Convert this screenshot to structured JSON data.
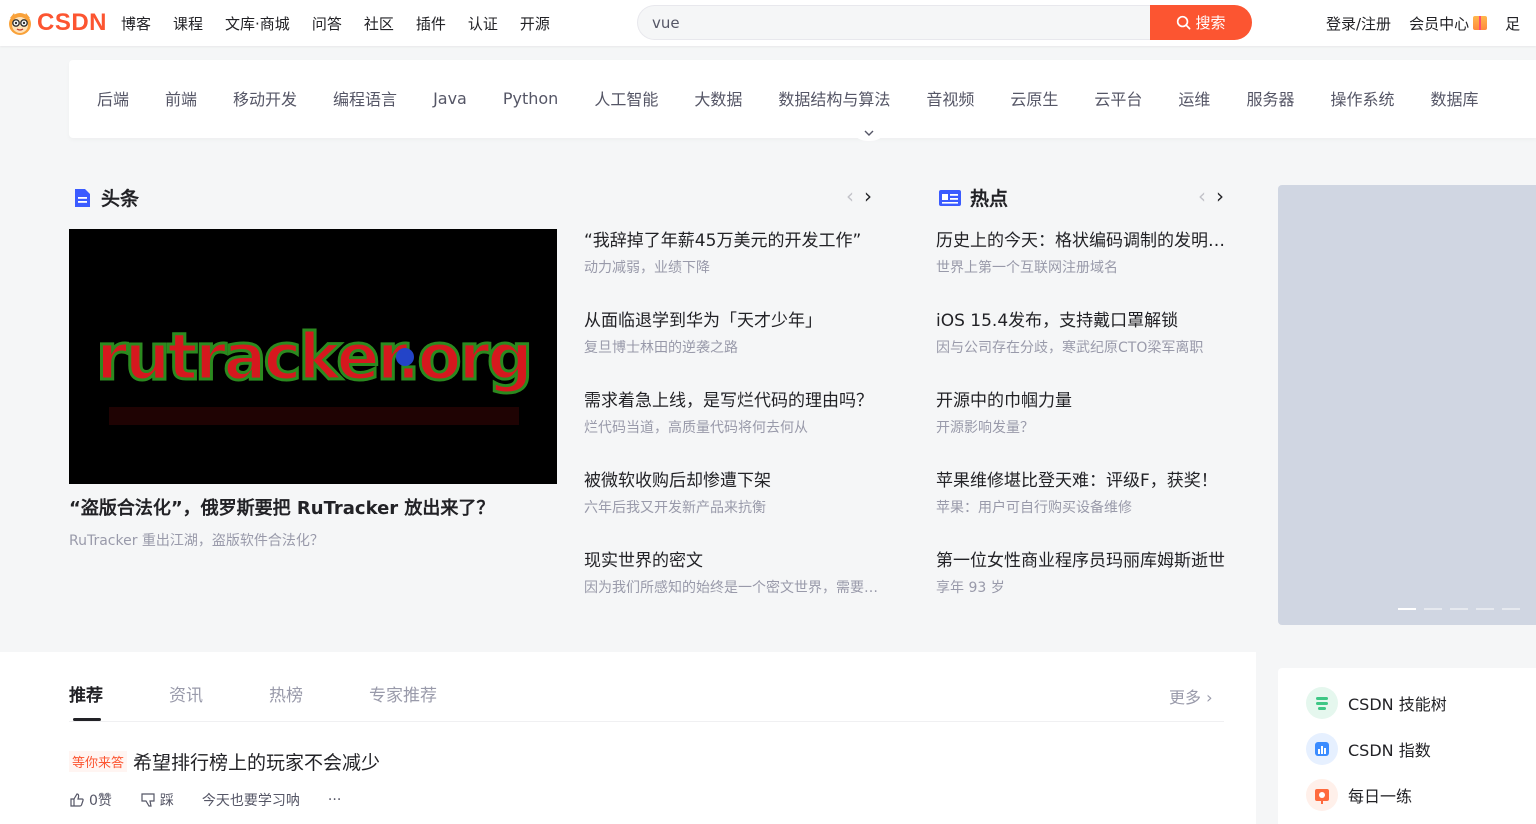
{
  "header": {
    "logo_text": "CSDN",
    "nav": [
      "博客",
      "课程",
      "文库·商城",
      "问答",
      "社区",
      "插件",
      "认证",
      "开源"
    ],
    "search": {
      "value": "vue",
      "button_label": "搜索"
    },
    "login_label": "登录/注册",
    "vip_label": "会员中心",
    "more_label": "足"
  },
  "categories": [
    "后端",
    "前端",
    "移动开发",
    "编程语言",
    "Java",
    "Python",
    "人工智能",
    "大数据",
    "数据结构与算法",
    "音视频",
    "云原生",
    "云平台",
    "运维",
    "服务器",
    "操作系统",
    "数据库"
  ],
  "headline": {
    "title": "头条",
    "hero": {
      "image_text": "rutracker.org",
      "title": "“盗版合法化”，俄罗斯要把 RuTracker 放出来了？",
      "subtitle": "RuTracker 重出江湖，盗版软件合法化？"
    },
    "items": [
      {
        "title": "“我辞掉了年薪45万美元的开发工作”",
        "subtitle": "动力减弱，业绩下降"
      },
      {
        "title": "从面临退学到华为「天才少年」",
        "subtitle": "复旦博士林田的逆袭之路"
      },
      {
        "title": "需求着急上线，是写烂代码的理由吗？",
        "subtitle": "烂代码当道，高质量代码将何去何从"
      },
      {
        "title": "被微软收购后却惨遭下架",
        "subtitle": "六年后我又开发新产品来抗衡"
      },
      {
        "title": "现实世界的密文",
        "subtitle": "因为我们所感知的始终是一个密文世界，需要解码"
      }
    ]
  },
  "hot": {
    "title": "热点",
    "items": [
      {
        "title": "历史上的今天：格状编码调制的发明者诞生",
        "subtitle": "世界上第一个互联网注册域名"
      },
      {
        "title": "iOS 15.4发布，支持戴口罩解锁",
        "subtitle": "因与公司存在分歧，寒武纪原CTO梁军离职"
      },
      {
        "title": "开源中的巾帼力量",
        "subtitle": "开源影响发量？"
      },
      {
        "title": "苹果维修堪比登天难：评级F，获奖！",
        "subtitle": "苹果：用户可自行购买设备维修"
      },
      {
        "title": "第一位女性商业程序员玛丽库姆斯逝世",
        "subtitle": "享年 93 岁"
      }
    ]
  },
  "feed": {
    "tabs": [
      "推荐",
      "资讯",
      "热榜",
      "专家推荐"
    ],
    "more_label": "更多",
    "item": {
      "tag": "等你来答",
      "title": "希望排行榜上的玩家不会减少",
      "like_label": "0赞",
      "dislike_label": "踩",
      "extra_label": "今天也要学习呐",
      "more_label": "···"
    }
  },
  "tools": [
    {
      "label": "CSDN 技能树",
      "icon": "skill-tree-icon",
      "color": "#3ec785"
    },
    {
      "label": "CSDN 指数",
      "icon": "index-chart-icon",
      "color": "#3b8cff"
    },
    {
      "label": "每日一练",
      "icon": "daily-practice-icon",
      "color": "#ff6a3d"
    }
  ],
  "colors": {
    "brand": "#fc5531",
    "text": "#222226",
    "muted": "#999aaa"
  }
}
